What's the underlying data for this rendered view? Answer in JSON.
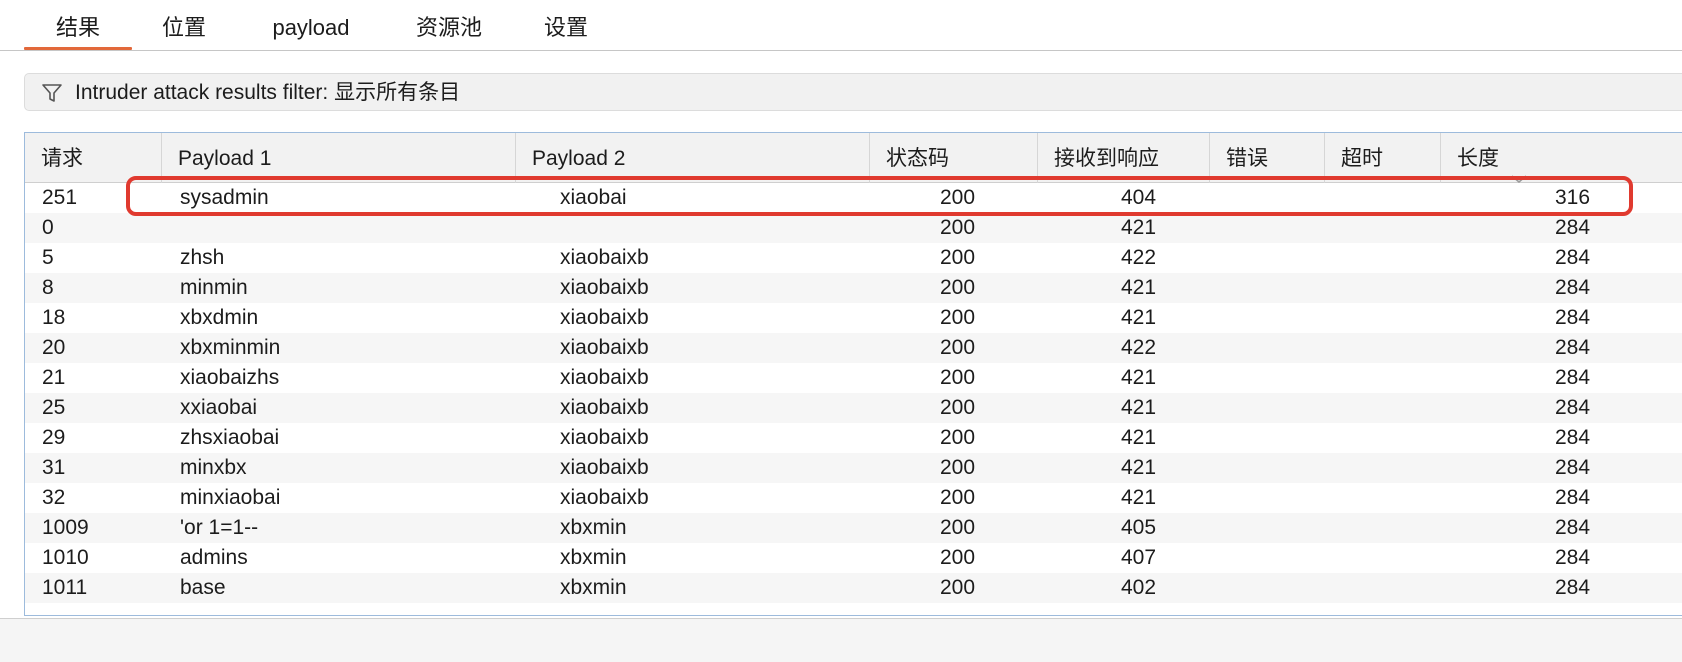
{
  "tabs": [
    {
      "label": "结果",
      "active": true
    },
    {
      "label": "位置",
      "active": false
    },
    {
      "label": "payload",
      "active": false
    },
    {
      "label": "资源池",
      "active": false
    },
    {
      "label": "设置",
      "active": false
    }
  ],
  "filter": {
    "icon": "filter-icon",
    "label": "Intruder attack results filter: 显示所有条目"
  },
  "table": {
    "columns": [
      "请求",
      "Payload 1",
      "Payload 2",
      "状态码",
      "接收到响应",
      "错误",
      "超时",
      "长度"
    ],
    "sort_icon": "chevron-down-icon",
    "sorted_column": "长度",
    "highlighted_row": 0,
    "rows": [
      [
        "251",
        "sysadmin",
        "xiaobai",
        "200",
        "404",
        "",
        "",
        "316"
      ],
      [
        "0",
        "",
        "",
        "200",
        "421",
        "",
        "",
        "284"
      ],
      [
        "5",
        "zhsh",
        "xiaobaixb",
        "200",
        "422",
        "",
        "",
        "284"
      ],
      [
        "8",
        "minmin",
        "xiaobaixb",
        "200",
        "421",
        "",
        "",
        "284"
      ],
      [
        "18",
        "xbxdmin",
        "xiaobaixb",
        "200",
        "421",
        "",
        "",
        "284"
      ],
      [
        "20",
        "xbxminmin",
        "xiaobaixb",
        "200",
        "422",
        "",
        "",
        "284"
      ],
      [
        "21",
        "xiaobaizhs",
        "xiaobaixb",
        "200",
        "421",
        "",
        "",
        "284"
      ],
      [
        "25",
        "xxiaobai",
        "xiaobaixb",
        "200",
        "421",
        "",
        "",
        "284"
      ],
      [
        "29",
        "zhsxiaobai",
        "xiaobaixb",
        "200",
        "421",
        "",
        "",
        "284"
      ],
      [
        "31",
        "minxbx",
        "xiaobaixb",
        "200",
        "421",
        "",
        "",
        "284"
      ],
      [
        "32",
        "minxiaobai",
        "xiaobaixb",
        "200",
        "421",
        "",
        "",
        "284"
      ],
      [
        "1009",
        "'or 1=1--",
        "xbxmin",
        "200",
        "405",
        "",
        "",
        "284"
      ],
      [
        "1010",
        "admins",
        "xbxmin",
        "200",
        "407",
        "",
        "",
        "284"
      ],
      [
        "1011",
        "base",
        "xbxmin",
        "200",
        "402",
        "",
        "",
        "284"
      ]
    ]
  },
  "colors": {
    "active_tab_underline": "#e2683a",
    "highlight_border": "#e03a2f",
    "table_border": "#9dbbdc"
  }
}
